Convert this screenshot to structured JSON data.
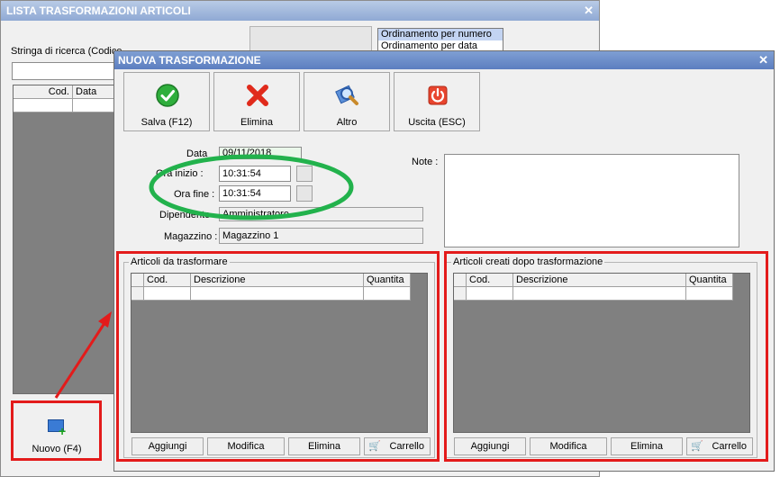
{
  "background_window": {
    "title": "LISTA TRASFORMAZIONI ARTICOLI",
    "search_label": "Stringa di ricerca (Codice",
    "search_value": "",
    "order_options": [
      "Ordinamento per numero",
      "Ordinamento per data"
    ],
    "grid_columns": [
      "Cod.",
      "Data"
    ],
    "new_button_label": "Nuovo (F4)"
  },
  "dialog": {
    "title": "NUOVA TRASFORMAZIONE",
    "toolbar": {
      "save": "Salva (F12)",
      "delete": "Elimina",
      "other": "Altro",
      "exit": "Uscita (ESC)"
    },
    "fields": {
      "date_label": "Data",
      "date_value": "09/11/2018",
      "start_time_label": "Ora inizio :",
      "start_time_value": "10:31:54",
      "end_time_label": "Ora fine :",
      "end_time_value": "10:31:54",
      "employee_label": "Dipendente",
      "employee_value": "Amministratore",
      "warehouse_label": "Magazzino :",
      "warehouse_value": "Magazzino 1",
      "note_label": "Note :",
      "note_value": ""
    },
    "panels": [
      {
        "title": "Articoli da trasformare",
        "columns": [
          "Cod.",
          "Descrizione",
          "Quantita"
        ],
        "buttons": [
          "Aggiungi",
          "Modifica",
          "Elimina",
          "Carrello"
        ]
      },
      {
        "title": "Articoli creati dopo trasformazione",
        "columns": [
          "Cod.",
          "Descrizione",
          "Quantita"
        ],
        "buttons": [
          "Aggiungi",
          "Modifica",
          "Elimina",
          "Carrello"
        ]
      }
    ]
  },
  "colors": {
    "highlight_red": "#e31b1b",
    "highlight_green": "#22b24c",
    "title_blue": "#5c7ec0"
  }
}
